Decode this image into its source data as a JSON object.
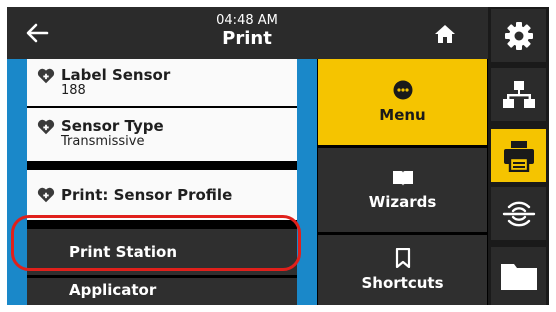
{
  "header": {
    "time": "04:48 AM",
    "title": "Print"
  },
  "list": {
    "items": [
      {
        "label": "Label Sensor",
        "value": "188"
      },
      {
        "label": "Sensor Type",
        "value": "Transmissive"
      },
      {
        "label": "Print: Sensor Profile"
      },
      {
        "label": "Print Station"
      },
      {
        "label": "Applicator"
      }
    ]
  },
  "menu": {
    "items": [
      {
        "label": "Menu"
      },
      {
        "label": "Wizards"
      },
      {
        "label": "Shortcuts"
      }
    ]
  },
  "colors": {
    "accent": "#f5c400",
    "list_border": "#1a88c9",
    "highlight": "#e0201b"
  },
  "icons": [
    "back-arrow-icon",
    "home-icon",
    "gear-icon",
    "network-icon",
    "printer-icon",
    "connection-icon",
    "folder-icon",
    "heart-plus-icon",
    "dots-icon",
    "book-icon",
    "bookmark-icon"
  ]
}
